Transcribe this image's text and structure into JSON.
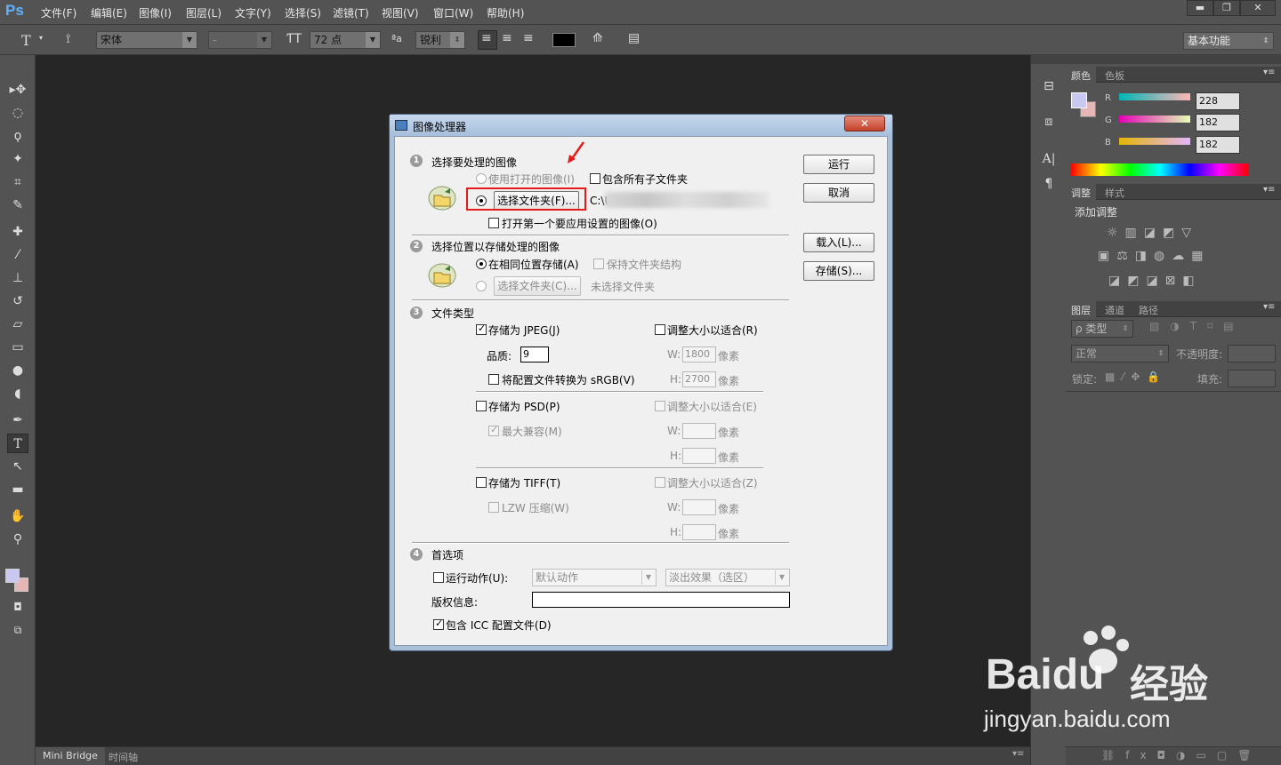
{
  "menubar": {
    "logo": "Ps",
    "items": [
      "文件(F)",
      "编辑(E)",
      "图像(I)",
      "图层(L)",
      "文字(Y)",
      "选择(S)",
      "滤镜(T)",
      "视图(V)",
      "窗口(W)",
      "帮助(H)"
    ],
    "win_min": "▬",
    "win_max": "❐",
    "win_close": "✕"
  },
  "options": {
    "font_family": "宋体",
    "font_style": "-",
    "font_size": "72 点",
    "aa_label": "ªa",
    "antialias": "锐利",
    "workspace": "基本功能"
  },
  "dialog": {
    "title": "图像处理器",
    "close": "✕",
    "s1": {
      "num": "1",
      "heading": "选择要处理的图像",
      "use_open": "使用打开的图像(I)",
      "include_sub": "包含所有子文件夹",
      "select_folder": "选择文件夹(F)...",
      "path": "C:\\U",
      "open_first": "打开第一个要应用设置的图像(O)"
    },
    "s2": {
      "num": "2",
      "heading": "选择位置以存储处理的图像",
      "same_loc": "在相同位置存储(A)",
      "keep_struct": "保持文件夹结构",
      "select_folder": "选择文件夹(C)...",
      "no_folder": "未选择文件夹"
    },
    "s3": {
      "num": "3",
      "heading": "文件类型",
      "save_jpeg": "存储为 JPEG(J)",
      "resize_r": "调整大小以适合(R)",
      "quality_label": "品质:",
      "quality": "9",
      "w_label": "W:",
      "h_label": "H:",
      "w_jpeg": "1800",
      "h_jpeg": "2700",
      "px": "像素",
      "convert_srgb": "将配置文件转换为 sRGB(V)",
      "save_psd": "存储为 PSD(P)",
      "resize_e": "调整大小以适合(E)",
      "max_compat": "最大兼容(M)",
      "save_tiff": "存储为 TIFF(T)",
      "resize_z": "调整大小以适合(Z)",
      "lzw": "LZW 压缩(W)"
    },
    "s4": {
      "num": "4",
      "heading": "首选项",
      "run_action": "运行动作(U):",
      "action_set": "默认动作",
      "action": "淡出效果（选区）",
      "copyright": "版权信息:",
      "include_icc": "包含 ICC 配置文件(D)"
    },
    "buttons": {
      "run": "运行",
      "cancel": "取消",
      "load": "载入(L)...",
      "save": "存储(S)..."
    }
  },
  "color_panel": {
    "tabs": [
      "颜色",
      "色板"
    ],
    "r_label": "R",
    "g_label": "G",
    "b_label": "B",
    "r": "228",
    "g": "182",
    "b": "182",
    "fg_color": "#c8c8f0",
    "bg_color": "#e4b6b6"
  },
  "adjust_panel": {
    "tabs": [
      "调整",
      "样式"
    ],
    "title": "添加调整"
  },
  "layers_panel": {
    "tabs": [
      "图层",
      "通道",
      "路径"
    ],
    "kind": "ρ 类型",
    "blend": "正常",
    "opacity_label": "不透明度:",
    "lock_label": "锁定:",
    "fill_label": "填充:"
  },
  "bottom_tabs": [
    "Mini Bridge",
    "时间轴"
  ],
  "watermark": {
    "brand": "Baidu",
    "cn": "经验",
    "url": "jingyan.baidu.com"
  }
}
